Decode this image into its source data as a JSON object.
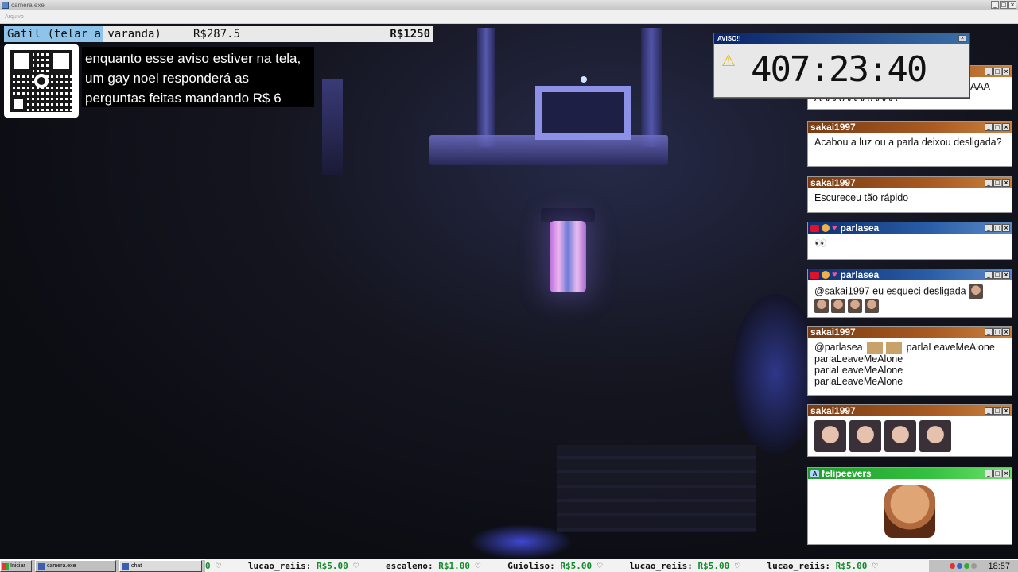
{
  "window": {
    "title": "camera.exe",
    "menu": "Arquivo"
  },
  "donation": {
    "goal_name": "Gatil (telar a varanda)",
    "raised": "R$287.5",
    "target": "R$1250",
    "progress_fraction": 0.23
  },
  "notice": {
    "text": "enquanto esse aviso estiver na tela, um gay noel responderá as perguntas feitas mandando R$ 6"
  },
  "timer": {
    "title": "AVISO!!",
    "value": "407:23:40"
  },
  "chat": {
    "top_partial": {
      "line1": "AAA",
      "line2": "AAAA AAAA AAAA"
    },
    "messages": [
      {
        "user": "sakai1997",
        "text": "Acabou a luz ou a parla deixou desligada?"
      },
      {
        "user": "sakai1997",
        "text": "Escureceu tão rápido"
      },
      {
        "user": "parlasea",
        "text": "👀"
      },
      {
        "user": "parlasea",
        "text": "@sakai1997 eu esqueci desligada"
      },
      {
        "user": "sakai1997",
        "text": "@parlasea",
        "text2": "parlaLeaveMeAlone",
        "lines": [
          "parlaLeaveMeAlone",
          "parlaLeaveMeAlone",
          "parlaLeaveMeAlone"
        ]
      },
      {
        "user": "sakai1997"
      },
      {
        "user": "felipeevers"
      }
    ]
  },
  "ticker": {
    "items": [
      {
        "user": "",
        "amount": "0"
      },
      {
        "user": "lucao_reiis:",
        "amount": "R$5.00"
      },
      {
        "user": "escaleno:",
        "amount": "R$1.00"
      },
      {
        "user": "Guioliso:",
        "amount": "R$5.00"
      },
      {
        "user": "lucao_reiis:",
        "amount": "R$5.00"
      },
      {
        "user": "lucao_reiis:",
        "amount": "R$5.00"
      }
    ]
  },
  "taskbar": {
    "start": "Iniciar",
    "task1": "camera.exe",
    "task2": "chat",
    "clock": "18:57"
  },
  "colors": {
    "accent": "#8fc4ea",
    "chat_head_orange": "#a85a22",
    "chat_head_blue": "#2a5ea8",
    "chat_head_green": "#35c140",
    "donation_green": "#118a2a"
  },
  "icons": {
    "warning": "warning-icon",
    "camera_badge": "camera-icon",
    "heart_badge": "heart-icon"
  }
}
